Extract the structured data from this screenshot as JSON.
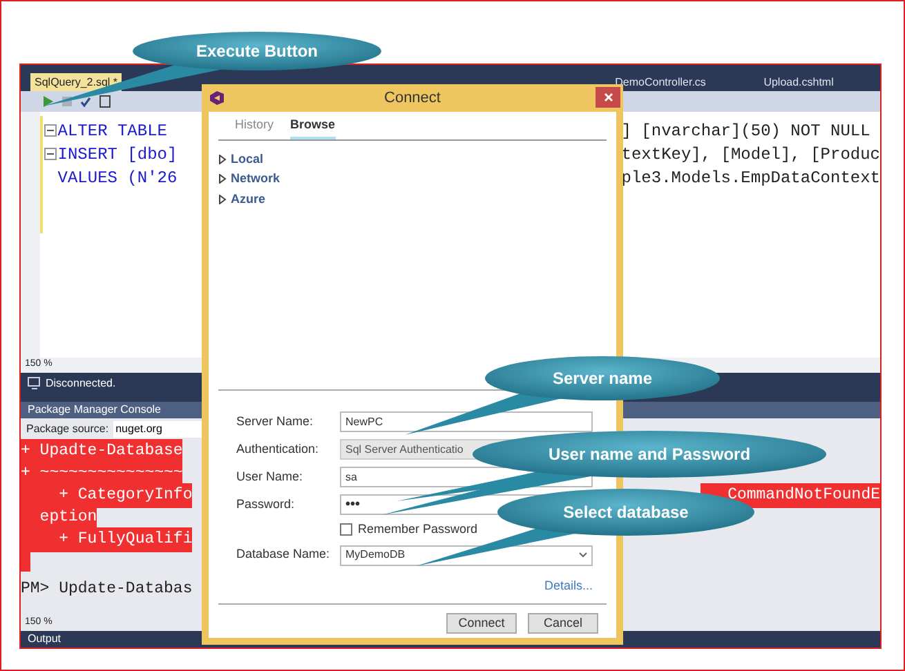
{
  "callouts": [
    {
      "text": "Execute Button"
    },
    {
      "text": "Server name"
    },
    {
      "text": "User name and Password"
    },
    {
      "text": "Select database"
    }
  ],
  "ide": {
    "tabs": [
      {
        "label": "SqlQuery_2.sql *",
        "selected": true
      },
      {
        "label": "DemoController.cs",
        "selected": false
      },
      {
        "label": "Upload.cshtml",
        "selected": false
      }
    ],
    "code_lines": [
      {
        "left": "ALTER TABLE",
        "right": "] [nvarchar](50) NOT NULL",
        "foldable": true
      },
      {
        "left": "INSERT [dbo]",
        "right": "textKey], [Model], [Produc",
        "foldable": true
      },
      {
        "left": "VALUES (N'26",
        "right": "ple3.Models.EmpDataContext",
        "foldable": false
      }
    ],
    "zoom": "150 %",
    "status": "Disconnected.",
    "console": {
      "title": "Package Manager Console",
      "source_label": "Package source:",
      "source": "nuget.org",
      "lines": [
        {
          "kind": "error",
          "text": "+ Upadte-Database"
        },
        {
          "kind": "error",
          "text": "+ ~~~~~~~~~~~~~~~"
        },
        {
          "kind": "error",
          "text": "    + CategoryInfo",
          "right": "CommandNotFoundE"
        },
        {
          "kind": "error",
          "text": "  eption"
        },
        {
          "kind": "error",
          "text": "    + FullyQualifi"
        },
        {
          "kind": "error-block"
        },
        {
          "kind": "prompt",
          "text": "PM> Update-Databas"
        }
      ],
      "zoom": "150 %"
    },
    "output_tab": "Output"
  },
  "dialog": {
    "title": "Connect",
    "tabs": [
      {
        "label": "History",
        "selected": false
      },
      {
        "label": "Browse",
        "selected": true
      }
    ],
    "tree": [
      {
        "label": "Local",
        "expanded": false
      },
      {
        "label": "Network",
        "expanded": false
      },
      {
        "label": "Azure",
        "expanded": false
      }
    ],
    "fields": [
      {
        "kind": "text",
        "label": "Server Name:",
        "value": "NewPC"
      },
      {
        "kind": "select-disabled",
        "label": "Authentication:",
        "value": "Sql Server Authenticatio"
      },
      {
        "kind": "text",
        "label": "User Name:",
        "value": "sa"
      },
      {
        "kind": "password",
        "label": "Password:",
        "value": "•••"
      },
      {
        "kind": "checkbox",
        "label": "Remember Password",
        "checked": false
      },
      {
        "kind": "dropdown",
        "label": "Database Name:",
        "value": "MyDemoDB"
      }
    ],
    "link": "Details...",
    "buttons": [
      {
        "label": "Connect"
      },
      {
        "label": "Cancel"
      }
    ]
  }
}
